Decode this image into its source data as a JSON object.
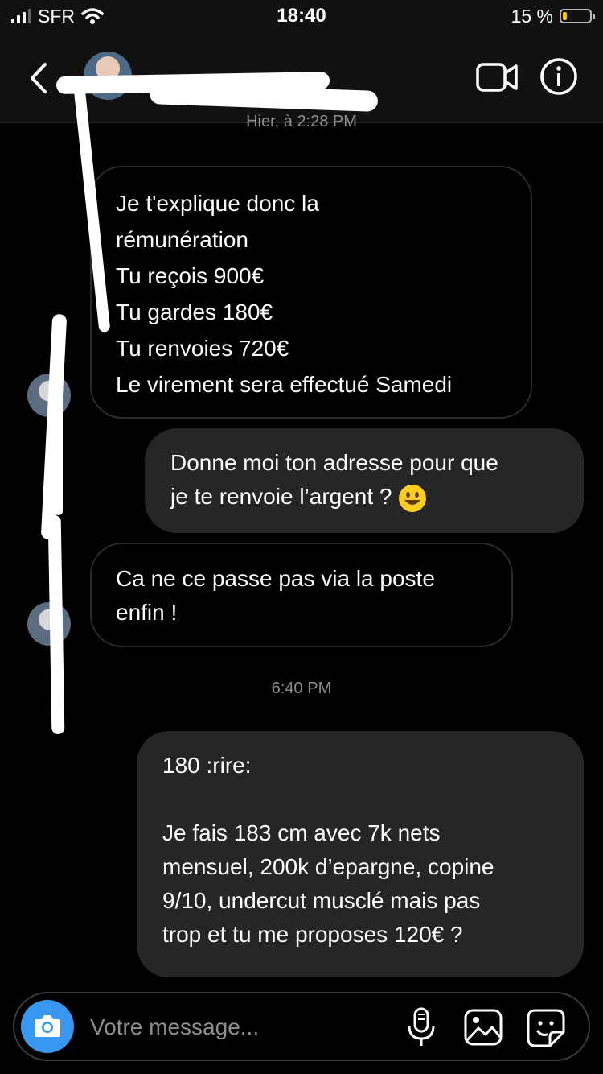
{
  "status_bar": {
    "carrier": "SFR",
    "time": "18:40",
    "battery_percent": "15 %",
    "battery_level": 0.15,
    "battery_color": "#f5c400"
  },
  "conversation": {
    "timestamp_earlier": "Hier, à 2:28 PM",
    "timestamp_later": "6:40 PM",
    "messages": [
      {
        "direction": "incoming",
        "text": "Je t'explique donc la\nrémunération\nTu reçois 900€\nTu gardes 180€\nTu renvoies 720€\nLe virement sera effectué Samedi"
      },
      {
        "direction": "outgoing",
        "text": "Donne moi ton adresse pour que\nje te renvoie l’argent ? ",
        "emoji": "smiling-face"
      },
      {
        "direction": "incoming",
        "text": "Ca ne ce passe pas via la poste\nenfin !"
      },
      {
        "direction": "outgoing",
        "text": "180 :rire:\n\nJe fais 183 cm avec 7k nets\nmensuel, 200k d’epargne, copine\n9/10, undercut musclé mais pas\ntrop et tu me proposes 120€ ?"
      }
    ]
  },
  "composer": {
    "placeholder": "Votre message..."
  },
  "colors": {
    "accent": "#3897f0",
    "outgoing_bubble": "#262626",
    "background": "#000000"
  }
}
